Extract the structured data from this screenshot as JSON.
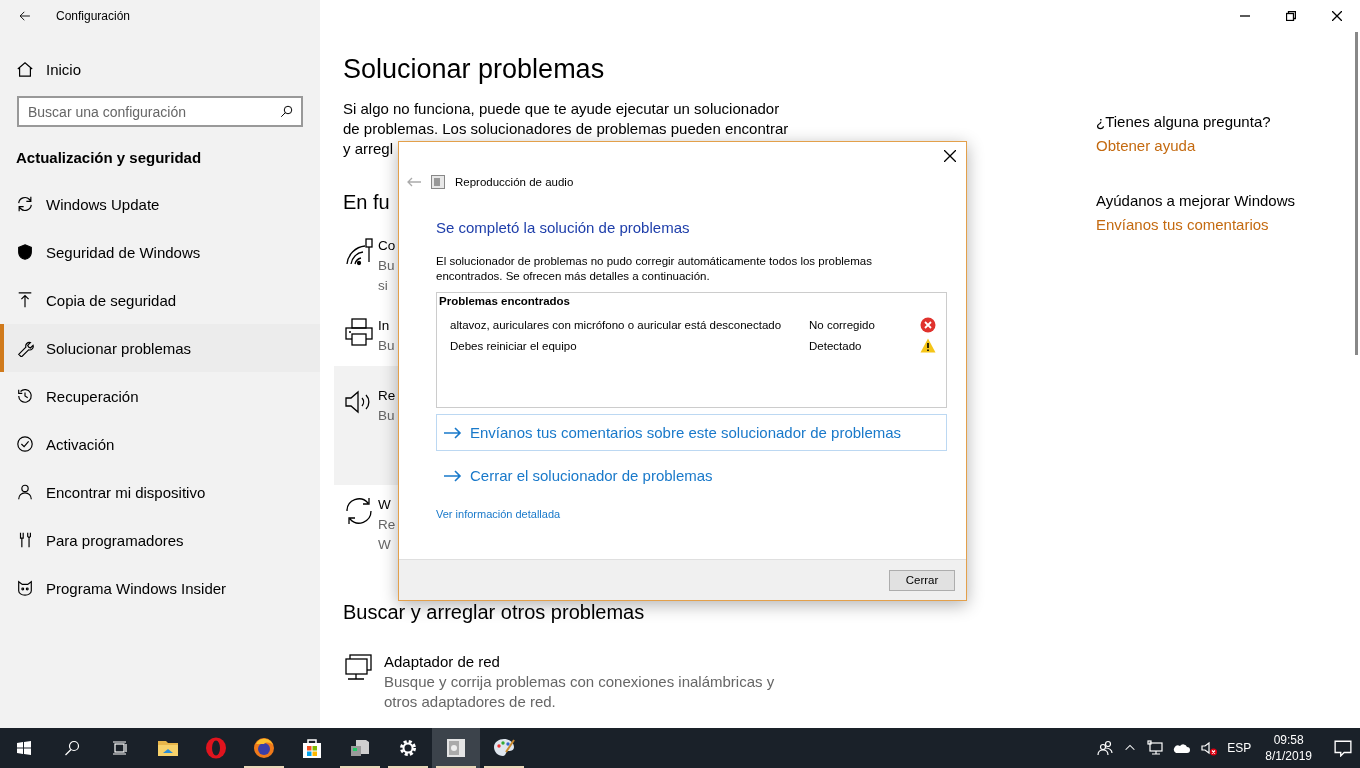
{
  "window": {
    "title": "Configuración"
  },
  "sidebar": {
    "home": "Inicio",
    "search": {
      "placeholder": "Buscar una configuración"
    },
    "section": "Actualización y seguridad",
    "items": [
      {
        "kind": "update",
        "label": "Windows Update",
        "selected": false
      },
      {
        "kind": "shield",
        "label": "Seguridad de Windows",
        "selected": false
      },
      {
        "kind": "backup",
        "label": "Copia de seguridad",
        "selected": false
      },
      {
        "kind": "wrench",
        "label": "Solucionar problemas",
        "selected": true
      },
      {
        "kind": "recovery",
        "label": "Recuperación",
        "selected": false
      },
      {
        "kind": "activation",
        "label": "Activación",
        "selected": false
      },
      {
        "kind": "find",
        "label": "Encontrar mi dispositivo",
        "selected": false
      },
      {
        "kind": "developer",
        "label": "Para programadores",
        "selected": false
      },
      {
        "kind": "insider",
        "label": "Programa Windows Insider",
        "selected": false
      }
    ]
  },
  "main": {
    "title": "Solucionar problemas",
    "intro": "Si algo no funciona, puede que te ayude ejecutar un solucionador de problemas. Los solucionadores de problemas pueden encontrar y arregl",
    "section": "En fu",
    "items": [
      {
        "kind": "connections",
        "title": "Co",
        "description": [
          "Bu",
          "si"
        ],
        "selected": false
      },
      {
        "kind": "printer",
        "title": "In",
        "description": [
          "Bu"
        ],
        "selected": false
      },
      {
        "kind": "audio",
        "title": "Re",
        "description": [
          "Bu"
        ],
        "selected": true
      },
      {
        "kind": "update",
        "title": "W",
        "description": [
          "Re",
          "W"
        ],
        "selected": false
      }
    ],
    "other_section": "Buscar y arreglar otros problemas",
    "other_items": [
      {
        "kind": "network",
        "title": "Adaptador de red",
        "description": [
          "Busque y corrija problemas con conexiones inalámbricas y",
          "otros adaptadores de red."
        ],
        "selected": false
      }
    ]
  },
  "aside": {
    "question": "¿Tienes alguna pregunta?",
    "help_link": "Obtener ayuda",
    "improve": "Ayúdanos a mejorar Windows",
    "feedback_link": "Envíanos tus comentarios"
  },
  "dialog": {
    "title": "Reproducción de audio",
    "heading": "Se completó la solución de problemas",
    "message": "El solucionador de problemas no pudo corregir automáticamente todos los problemas encontrados. Se ofrecen más detalles a continuación.",
    "problems_header": "Problemas encontrados",
    "problems": [
      {
        "description": "altavoz, auriculares con micrófono o auricular está desconectado",
        "status": "No corregido",
        "kind": "error"
      },
      {
        "description": "Debes reiniciar el equipo",
        "status": "Detectado",
        "kind": "warning"
      }
    ],
    "links": [
      {
        "label": "Envíanos tus comentarios sobre este solucionador de problemas",
        "selected": true
      },
      {
        "label": "Cerrar el solucionador de problemas",
        "selected": false
      }
    ],
    "details_link": "Ver información detallada",
    "close_button": "Cerrar"
  },
  "taskbar": {
    "apps": [
      {
        "kind": "explorer",
        "running": false,
        "active": false
      },
      {
        "kind": "opera",
        "running": false,
        "active": false
      },
      {
        "kind": "firefox",
        "running": true,
        "active": false
      },
      {
        "kind": "store",
        "running": false,
        "active": false
      },
      {
        "kind": "program",
        "running": true,
        "active": false
      },
      {
        "kind": "settings",
        "running": true,
        "active": false
      },
      {
        "kind": "troubleshooter",
        "running": true,
        "active": true
      },
      {
        "kind": "paint",
        "running": true,
        "active": false
      }
    ],
    "language": "ESP",
    "time": "09:58",
    "date": "8/1/2019"
  }
}
